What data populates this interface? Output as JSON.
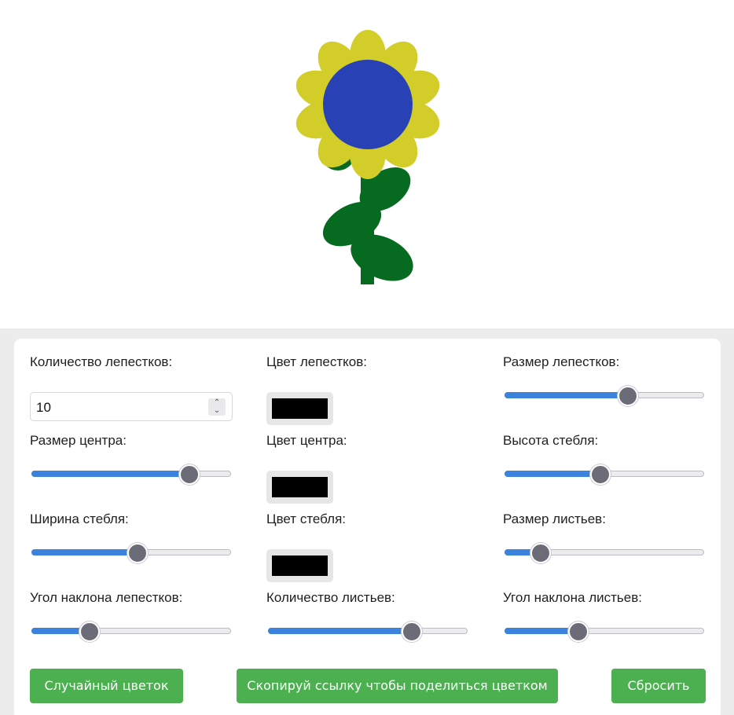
{
  "colors": {
    "petal": "#d3cd2a",
    "center": "#2842b6",
    "stem": "#066a21",
    "accent": "#4caf50",
    "slider_fill": "#3b82dc"
  },
  "controls": {
    "petal_count": {
      "label": "Количество лепестков:",
      "value": "10"
    },
    "petal_color": {
      "label": "Цвет лепестков:",
      "value": "#000000"
    },
    "petal_size": {
      "label": "Размер лепестков:",
      "level": 0.62
    },
    "center_size": {
      "label": "Размер центра:",
      "level": 0.79
    },
    "center_color": {
      "label": "Цвет центра:",
      "value": "#000000"
    },
    "stem_height": {
      "label": "Высота стебля:",
      "level": 0.48
    },
    "stem_width": {
      "label": "Ширина стебля:",
      "level": 0.53
    },
    "stem_color": {
      "label": "Цвет стебля:",
      "value": "#000000"
    },
    "leaf_size": {
      "label": "Размер листьев:",
      "level": 0.18
    },
    "petal_angle": {
      "label": "Угол наклона лепестков:",
      "level": 0.29
    },
    "leaf_count": {
      "label": "Количество листьев:",
      "level": 0.72
    },
    "leaf_angle": {
      "label": "Угол наклона листьев:",
      "level": 0.37
    }
  },
  "buttons": {
    "random": "Случайный цветок",
    "share": "Скопируй ссылку чтобы поделиться цветком",
    "reset": "Сбросить"
  }
}
